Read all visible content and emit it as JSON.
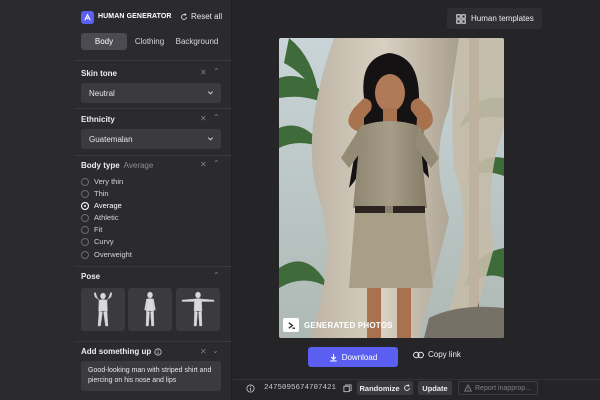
{
  "app": {
    "brand": "HUMAN GENERATOR",
    "reset_label": "Reset all",
    "accent": "#5a5ff2"
  },
  "tabs": [
    {
      "label": "Body",
      "active": true
    },
    {
      "label": "Clothing",
      "active": false
    },
    {
      "label": "Background",
      "active": false
    }
  ],
  "sections": {
    "skin_tone": {
      "title": "Skin tone",
      "value": "Neutral"
    },
    "ethnicity": {
      "title": "Ethnicity",
      "value": "Guatemalan"
    },
    "body_type": {
      "title": "Body type",
      "subtitle": "Average",
      "options": [
        "Very thin",
        "Thin",
        "Average",
        "Athletic",
        "Fit",
        "Curvy",
        "Overweight"
      ],
      "selected": "Average"
    },
    "pose": {
      "title": "Pose"
    },
    "add_something": {
      "title": "Add something up",
      "text": "Good-looking man with striped shirt and piercing on his nose and lips"
    }
  },
  "main": {
    "templates_label": "Human templates",
    "watermark": "GENERATED PHOTOS",
    "download_label": "Download",
    "copy_link_label": "Copy link"
  },
  "bottom": {
    "seed": "2475095674707421",
    "randomize_label": "Randomize",
    "update_label": "Update",
    "report_label": "Report inapprop..."
  }
}
